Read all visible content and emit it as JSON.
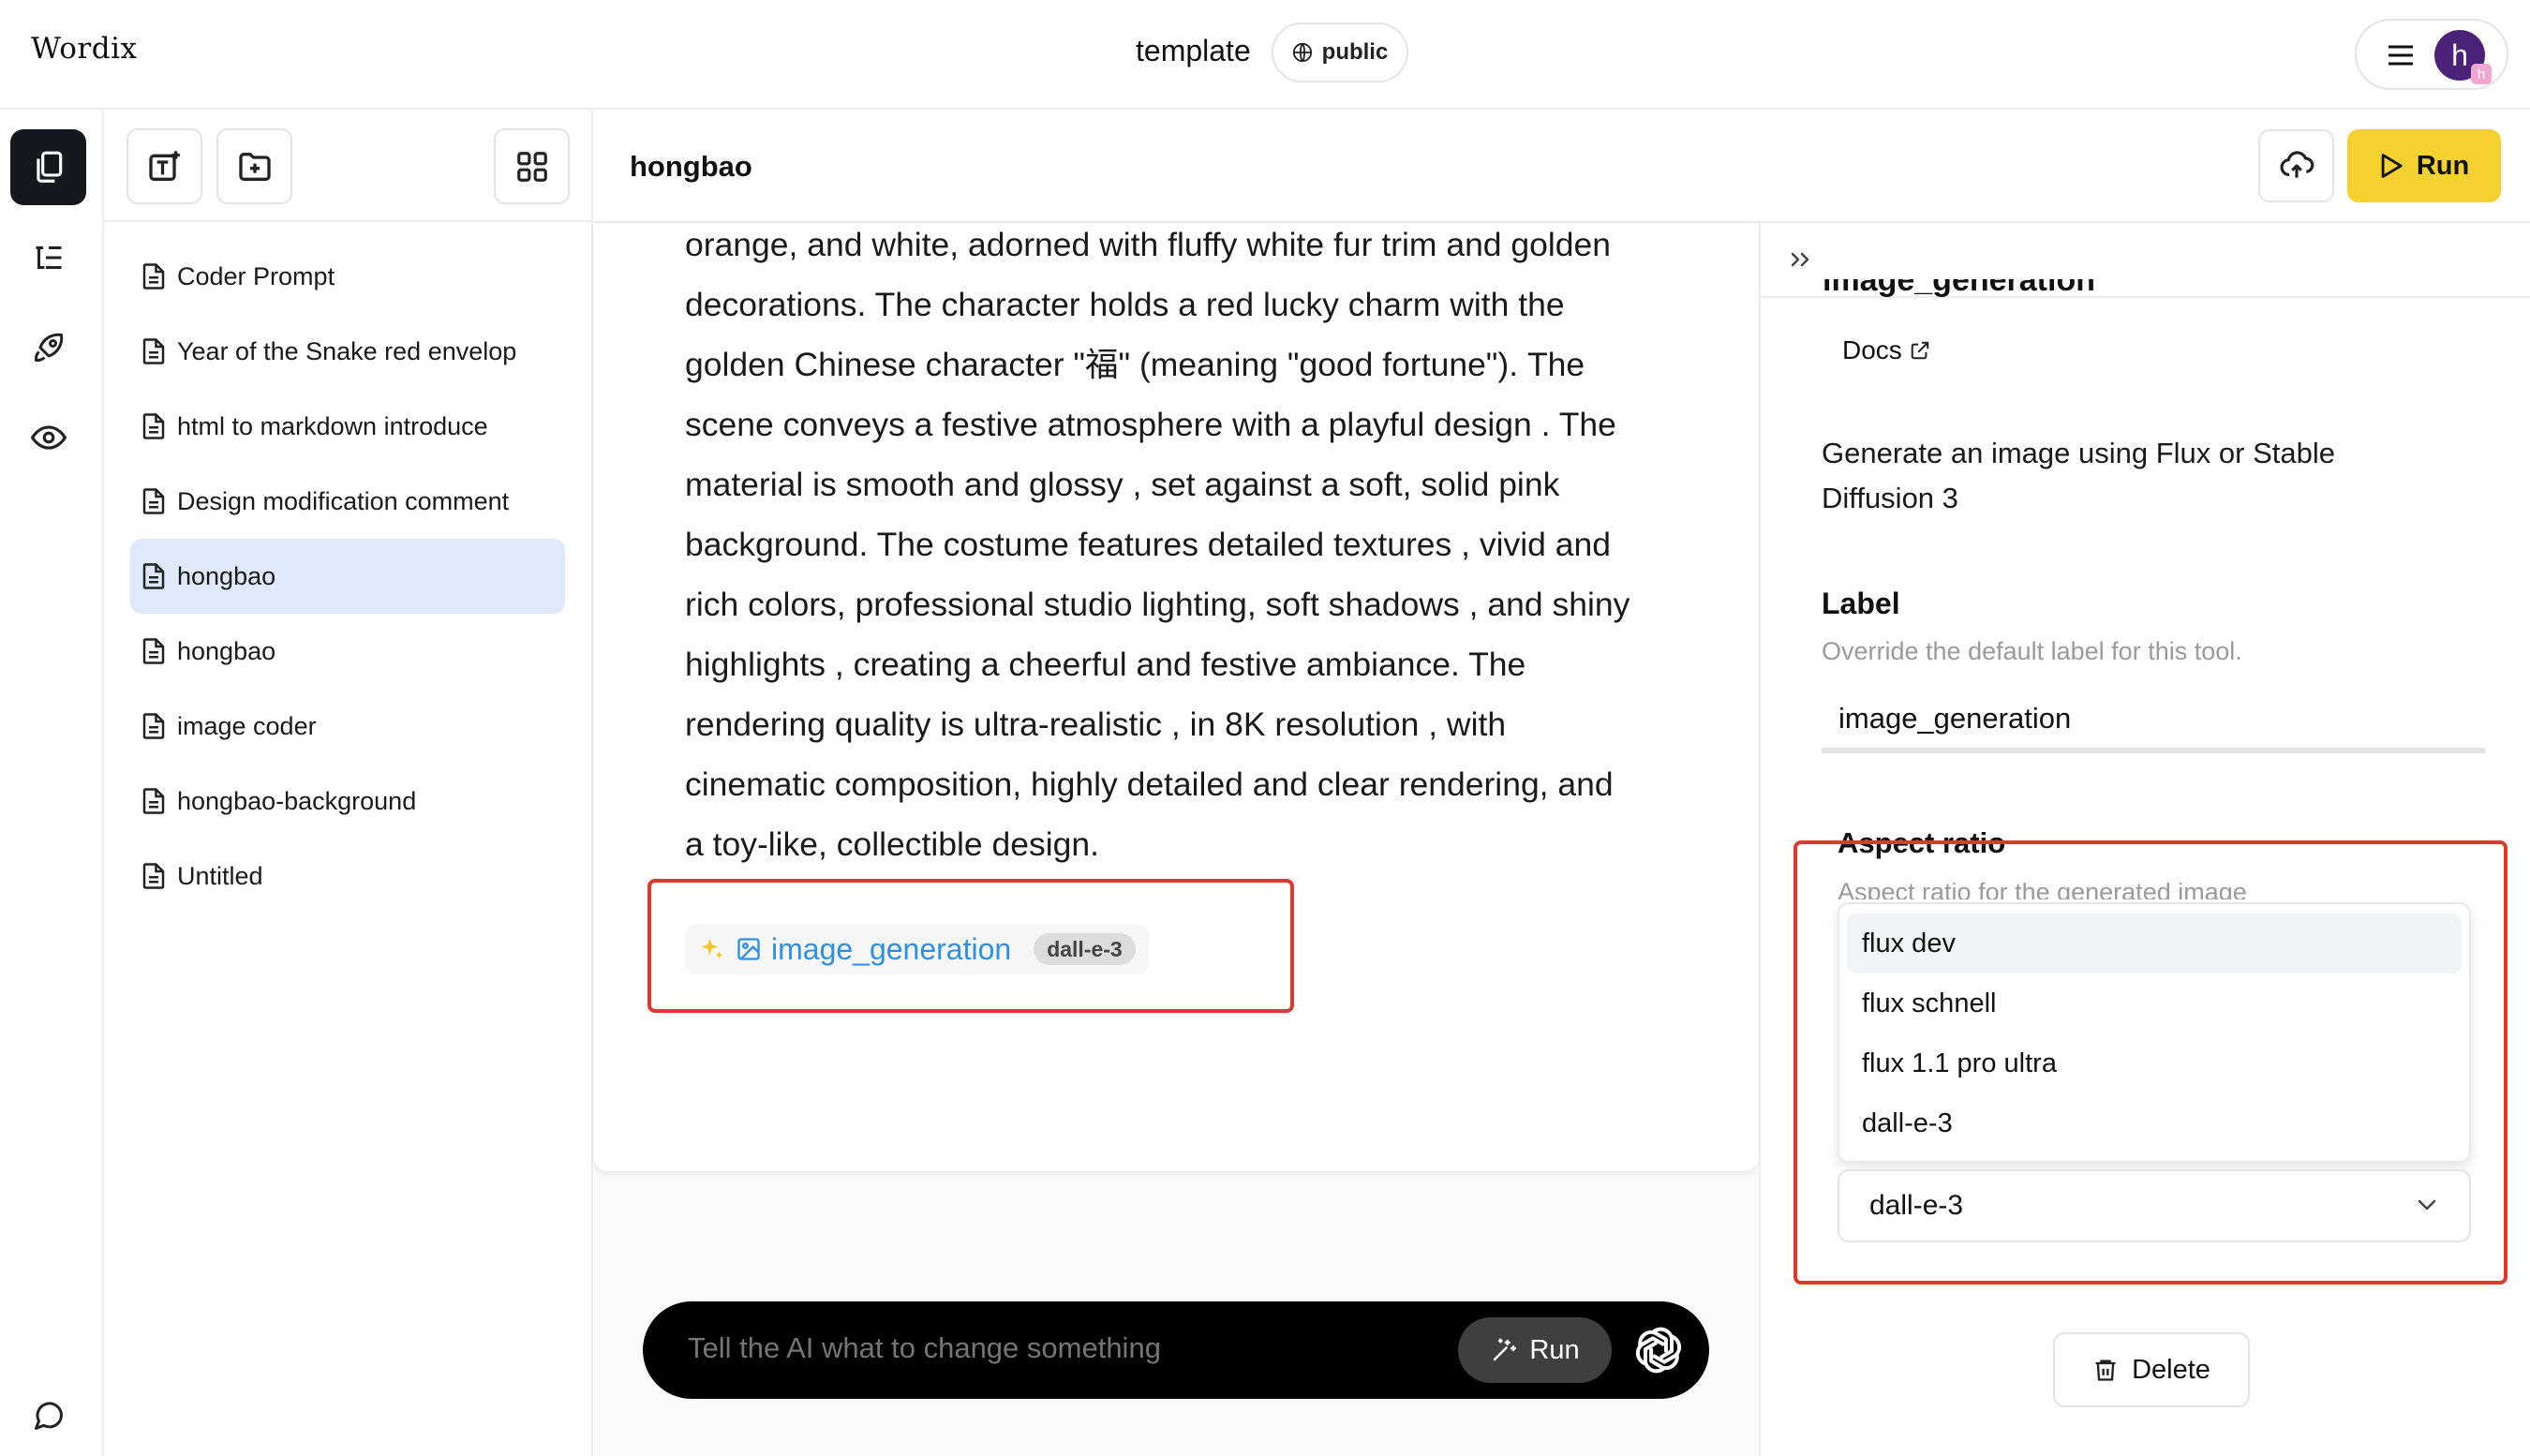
{
  "app": {
    "logo": "Wordix"
  },
  "header": {
    "doc_title": "template",
    "visibility": "public",
    "avatar_initial": "h",
    "avatar_badge": "h"
  },
  "rail": {
    "items": [
      "files-icon",
      "outline-icon",
      "rocket-icon",
      "eye-icon",
      "chat-icon"
    ]
  },
  "files": {
    "items": [
      {
        "label": "Coder Prompt"
      },
      {
        "label": "Year of the Snake red envelop"
      },
      {
        "label": "html to markdown introduce"
      },
      {
        "label": "Design modification comment"
      },
      {
        "label": "hongbao",
        "selected": true
      },
      {
        "label": "hongbao"
      },
      {
        "label": "image coder"
      },
      {
        "label": "hongbao-background"
      },
      {
        "label": "Untitled"
      }
    ]
  },
  "editor": {
    "name": "hongbao",
    "run_label": "Run",
    "lines": [
      "orange, and white, adorned with fluffy white fur trim and golden",
      "decorations.  The character holds a red lucky charm with the",
      "golden Chinese character \"福\" (meaning \"good fortune\"). The",
      "scene conveys a festive atmosphere with a playful design . The",
      "material is smooth and glossy , set against a soft, solid pink",
      "background. The costume features detailed textures , vivid and",
      "rich colors, professional studio lighting, soft shadows , and shiny",
      "highlights , creating a cheerful and festive ambiance.  The",
      "rendering quality is ultra-realistic , in 8K resolution , with",
      "cinematic composition, highly detailed and clear rendering, and",
      "a toy-like, collectible design."
    ],
    "tool_chip": {
      "name": "image_generation",
      "model": "dall-e-3"
    }
  },
  "prompt": {
    "placeholder": "Tell the AI what to change something",
    "run_label": "Run"
  },
  "tool_panel": {
    "title": "image_generation",
    "docs_label": "Docs",
    "description": "Generate an image using Flux or Stable Diffusion 3",
    "label_title": "Label",
    "label_help": "Override the default label for this tool.",
    "label_value": "image_generation",
    "aspect_title": "Aspect ratio",
    "aspect_help": "Aspect ratio for the generated image",
    "options": [
      "flux dev",
      "flux schnell",
      "flux 1.1 pro ultra",
      "dall-e-3"
    ],
    "hovered_option": "flux dev",
    "selected_value": "dall-e-3",
    "delete_label": "Delete"
  },
  "colors": {
    "accent_run": "#f5d130",
    "highlight_box": "#e2382b",
    "chip_link": "#2f8fe0",
    "selected_row": "#dfe9fb"
  }
}
